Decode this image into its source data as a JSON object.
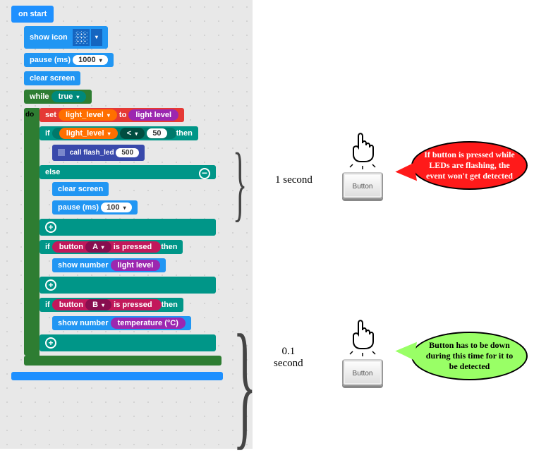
{
  "blocks": {
    "on_start": "on start",
    "show_icon": "show icon",
    "pause_ms": "pause (ms)",
    "pause1_value": "1000",
    "clear_screen": "clear screen",
    "while": "while",
    "true": "true",
    "do": "do",
    "set": "set",
    "light_level_var": "light_level",
    "to": "to",
    "light_level": "light level",
    "if": "if",
    "lt": "<",
    "threshold": "50",
    "then": "then",
    "call_flash_led": "call flash_led",
    "flash_led_arg": "500",
    "else": "else",
    "pause2_value": "100",
    "button": "button",
    "A": "A",
    "B": "B",
    "is_pressed": "is pressed",
    "show_number": "show number",
    "temperature": "temperature (°C)"
  },
  "annotations": {
    "brace1_label": "1 second",
    "brace2_label": "0.1\nsecond",
    "button_label": "Button",
    "speech_red": "If button is pressed while LEDs are flashing, the event won't get detected",
    "speech_green": "Button has to be down during this time for it to be detected"
  },
  "colors": {
    "basic": "#2196f3",
    "loops": "#2e7d32",
    "logic": "#009688",
    "variables": "#e53935",
    "input": "#c2185b",
    "purple": "#9c27b0",
    "functions": "#3949ab"
  }
}
